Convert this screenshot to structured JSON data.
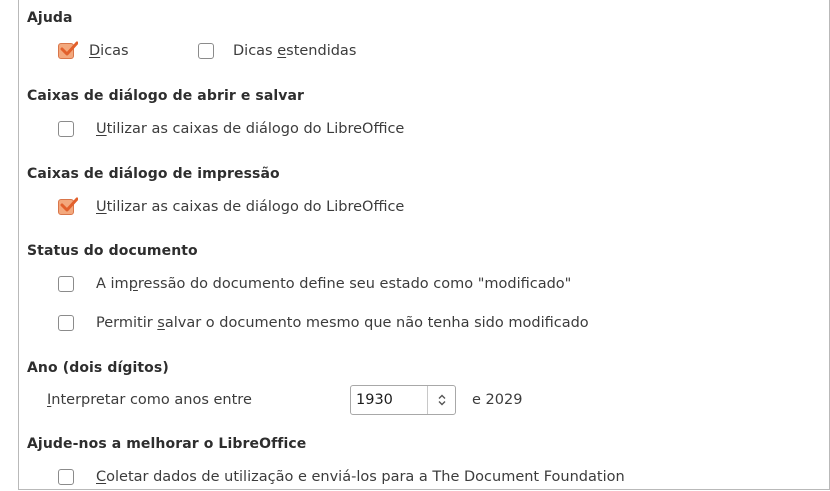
{
  "help": {
    "title": "Ajuda",
    "tips": {
      "pre": "",
      "key": "D",
      "post": "icas",
      "checked": true
    },
    "extended_tips": {
      "pre": "Dicas ",
      "key": "e",
      "post": "stendidas",
      "checked": false
    }
  },
  "open_save": {
    "title": "Caixas de diálogo de abrir e salvar",
    "use_lo_dialogs": {
      "pre": "",
      "key": "U",
      "post": "tilizar as caixas de diálogo do LibreOffice",
      "checked": false
    }
  },
  "print": {
    "title": "Caixas de diálogo de impressão",
    "use_lo_dialogs": {
      "pre": "",
      "key": "U",
      "post": "tilizar as caixas de diálogo do LibreOffice",
      "checked": true
    }
  },
  "doc_status": {
    "title": "Status do documento",
    "print_modifies": {
      "pre": "A im",
      "key": "p",
      "post": "ressão do documento define seu estado como \"modificado\"",
      "checked": false
    },
    "allow_save": {
      "pre": "Permitir ",
      "key": "s",
      "post": "alvar o documento mesmo que não tenha sido modificado",
      "checked": false
    }
  },
  "year": {
    "title": "Ano (dois dígitos)",
    "label": {
      "pre": "",
      "key": "I",
      "post": "nterpretar como anos entre"
    },
    "value": "1930",
    "end_text": "e 2029"
  },
  "improve": {
    "title": "Ajude-nos a melhorar o LibreOffice",
    "collect": {
      "pre": "",
      "key": "C",
      "post": "oletar dados de utilização e enviá-los para a The Document Foundation",
      "checked": false
    }
  },
  "colors": {
    "checked_fill": "#f3a87d",
    "checked_border": "#d9764a",
    "tick": "#e2602c"
  },
  "icons": {
    "check": "check-icon",
    "spin": "spin-updown-icon"
  }
}
